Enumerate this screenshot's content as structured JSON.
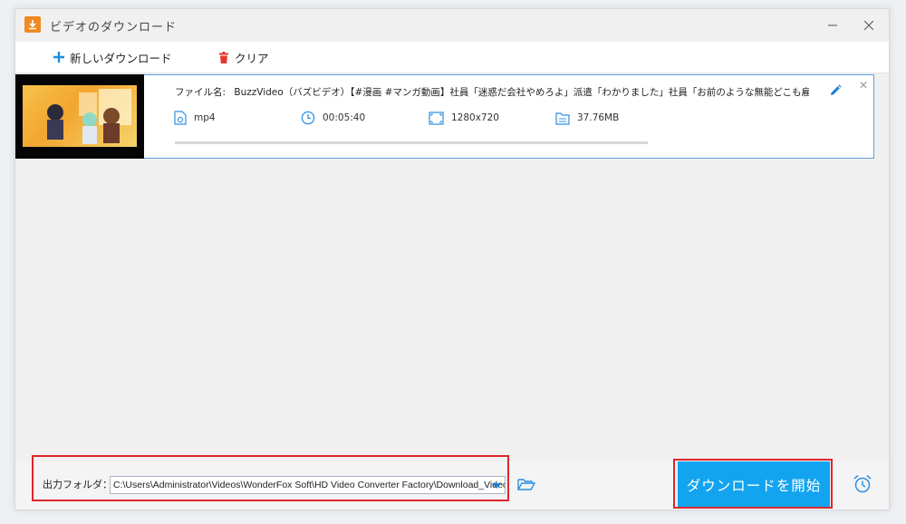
{
  "window": {
    "title": "ビデオのダウンロード"
  },
  "toolbar": {
    "new_download_label": "新しいダウンロード",
    "clear_label": "クリア"
  },
  "item": {
    "filename_label": "ファイル名:",
    "filename": "BuzzVideo（バズビデオ）【#漫画 #マンガ動画】社員「迷惑だ会社やめろよ」派遣「わかりました」社員「お前のような無能どこも雇って…",
    "format": "mp4",
    "duration": "00:05:40",
    "resolution": "1280x720",
    "size": "37.76MB",
    "progress": 0
  },
  "bottom": {
    "output_label": "出力フォルダ：",
    "output_path": "C:\\Users\\Administrator\\Videos\\WonderFox Soft\\HD Video Converter Factory\\Download_Video\\",
    "start_label": "ダウンロードを開始"
  },
  "colors": {
    "accent": "#13a4f0",
    "highlight": "#e0262b",
    "card_border": "#5aa2e0"
  }
}
